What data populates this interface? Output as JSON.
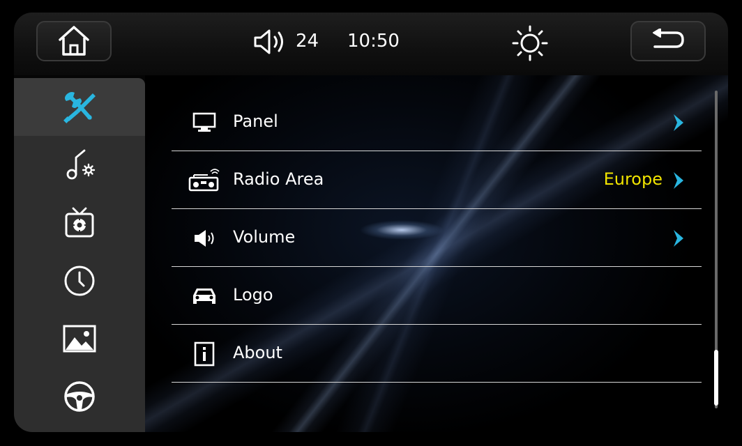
{
  "header": {
    "volume_value": "24",
    "time": "10:50"
  },
  "sidebar": {
    "items": [
      {
        "icon": "tools-icon",
        "active": true
      },
      {
        "icon": "music-settings-icon",
        "active": false
      },
      {
        "icon": "tv-settings-icon",
        "active": false
      },
      {
        "icon": "clock-icon",
        "active": false
      },
      {
        "icon": "image-icon",
        "active": false
      },
      {
        "icon": "steering-wheel-icon",
        "active": false
      }
    ]
  },
  "menu": {
    "items": [
      {
        "label": "Panel",
        "icon": "monitor-icon",
        "value": ""
      },
      {
        "label": "Radio Area",
        "icon": "radio-icon",
        "value": "Europe"
      },
      {
        "label": "Volume",
        "icon": "speaker-icon",
        "value": ""
      },
      {
        "label": "Logo",
        "icon": "car-icon",
        "value": ""
      },
      {
        "label": "About",
        "icon": "info-icon",
        "value": ""
      }
    ]
  },
  "colors": {
    "accent": "#29b6e0",
    "value_text": "#f1e400",
    "sidebar_bg": "#2e2e2e"
  }
}
